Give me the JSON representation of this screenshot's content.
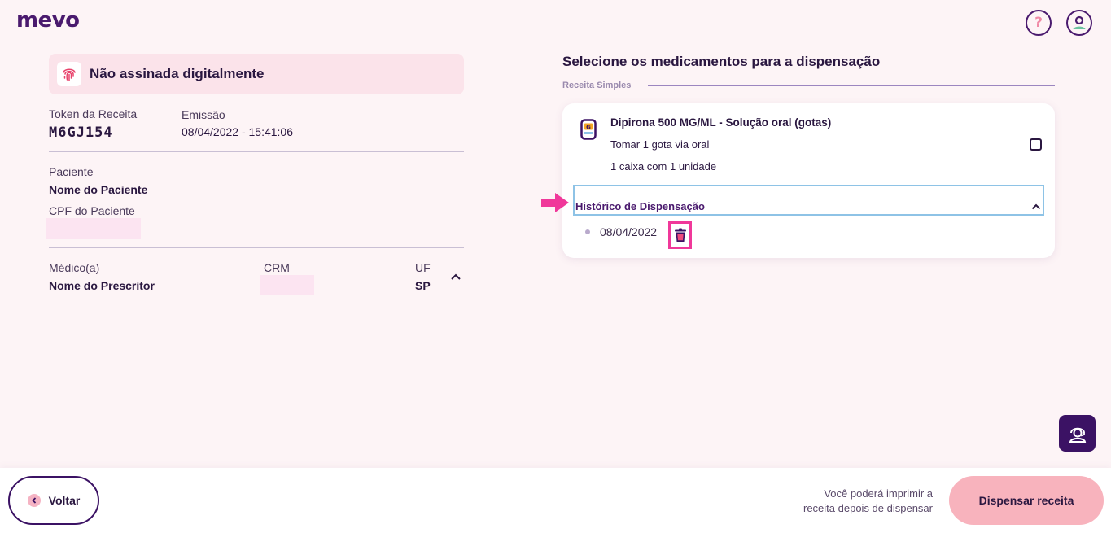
{
  "header": {
    "logo_text": "mevo",
    "help_glyph": "?",
    "help_icon": "question-icon",
    "profile_icon": "user-profile-icon"
  },
  "signature_banner": {
    "text": "Não assinada digitalmente",
    "icon": "fingerprint-icon"
  },
  "prescription": {
    "token_label": "Token da Receita",
    "token_value": "M6GJ154",
    "emission_label": "Emissão",
    "emission_value": "08/04/2022 - 15:41:06"
  },
  "patient": {
    "label": "Paciente",
    "name": "Nome do Paciente",
    "cpf_label": "CPF do Paciente"
  },
  "doctor": {
    "label": "Médico(a)",
    "name": "Nome do Prescritor",
    "crm_label": "CRM",
    "uf_label": "UF",
    "uf_value": "SP"
  },
  "medications": {
    "title": "Selecione os medicamentos para a dispensação",
    "subtitle": "Receita Simples",
    "items": [
      {
        "name": "Dipirona 500 MG/ML - Solução oral (gotas)",
        "dosage": "Tomar 1 gota via oral",
        "quantity": "1 caixa com 1 unidade",
        "checked": false,
        "history_label": "Histórico de Dispensação",
        "history": [
          {
            "date": "08/04/2022"
          }
        ]
      }
    ]
  },
  "footer": {
    "back_label": "Voltar",
    "print_note_line1": "Você poderá imprimir a",
    "print_note_line2": "receita depois de dispensar",
    "dispense_label": "Dispensar receita"
  },
  "colors": {
    "brand": "#4a1a6e",
    "background": "#fdf4f6",
    "dispense_button": "#f8b3bd",
    "highlight": "#f0389a",
    "history_border": "#8ec3e6"
  }
}
